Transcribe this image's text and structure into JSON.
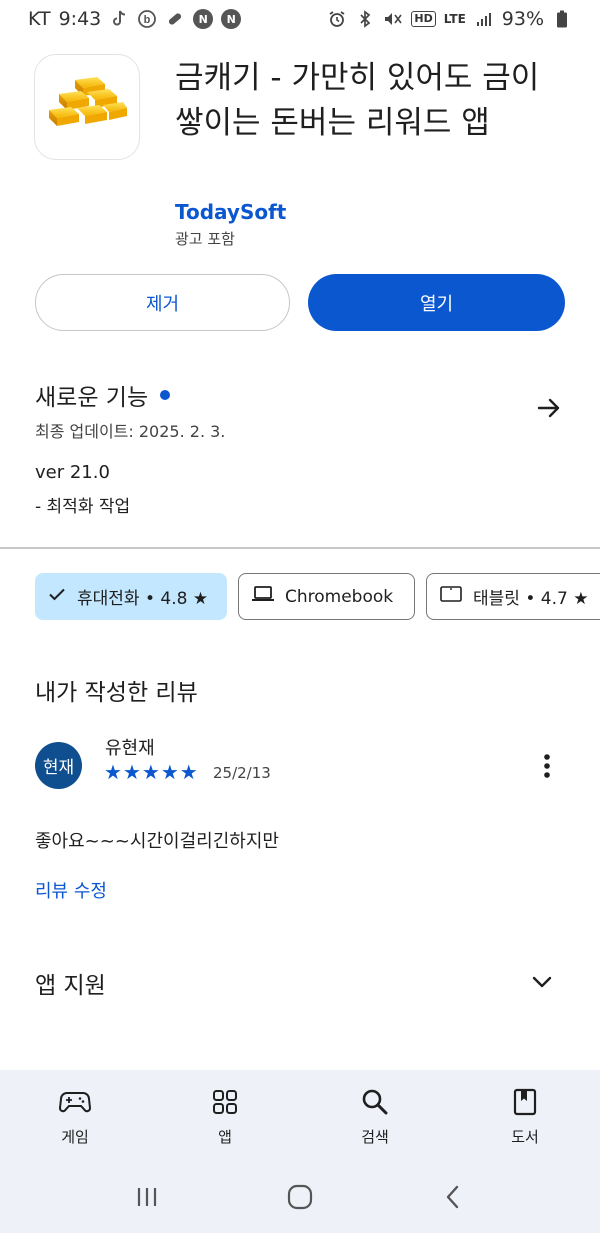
{
  "status_bar": {
    "carrier": "KT",
    "time": "9:43",
    "notification_badges": [
      "N",
      "N"
    ],
    "hd_label": "HD",
    "network": "LTE",
    "battery": "93%"
  },
  "app": {
    "title": "금캐기 - 가만히 있어도 금이 쌓이는 돈버는 리워드 앱",
    "developer": "TodaySoft",
    "ads_note": "광고 포함",
    "icon": "gold-bars-icon"
  },
  "actions": {
    "remove_label": "제거",
    "open_label": "열기"
  },
  "whats_new": {
    "title": "새로운 기능",
    "last_updated": "최종 업데이트: 2025. 2. 3.",
    "version": "ver 21.0",
    "note": "- 최적화 작업"
  },
  "device_chips": [
    {
      "label": "휴대전화 • 4.8 ★",
      "selected": true,
      "icon": "check-icon"
    },
    {
      "label": "Chromebook",
      "selected": false,
      "icon": "laptop-icon"
    },
    {
      "label": "태블릿 • 4.7 ★",
      "selected": false,
      "icon": "tablet-icon"
    }
  ],
  "my_review": {
    "section_title": "내가 작성한 리뷰",
    "avatar_text": "현재",
    "reviewer": "유현재",
    "rating": 5,
    "date": "25/2/13",
    "text": "좋아요~~~시간이걸리긴하지만",
    "edit_label": "리뷰 수정"
  },
  "app_support": {
    "title": "앱 지원"
  },
  "bottom_nav": [
    {
      "label": "게임",
      "icon": "gamepad-icon"
    },
    {
      "label": "앱",
      "icon": "apps-grid-icon"
    },
    {
      "label": "검색",
      "icon": "search-icon"
    },
    {
      "label": "도서",
      "icon": "book-icon"
    }
  ],
  "colors": {
    "accent": "#0b57d0",
    "chip_selected": "#c2e7ff",
    "nav_background": "#eef1f8",
    "avatar": "#0f4f8f"
  }
}
